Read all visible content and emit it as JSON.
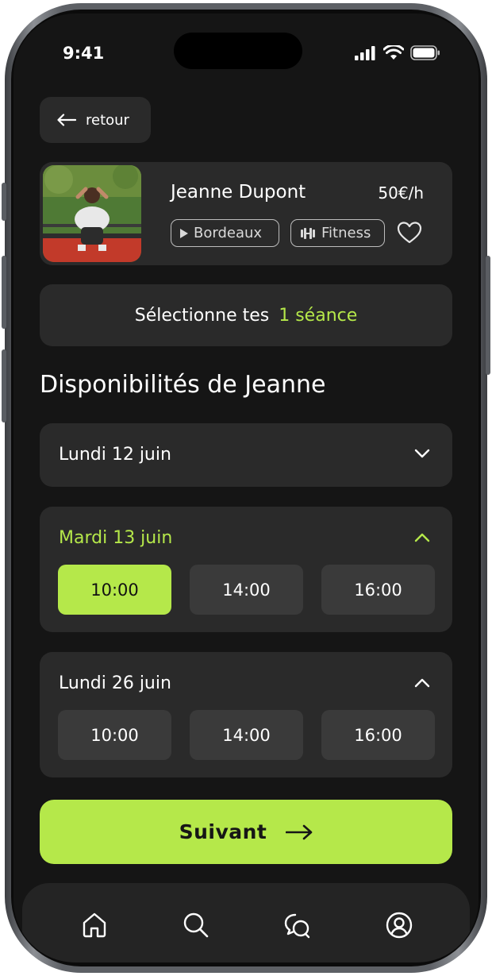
{
  "status_bar": {
    "time": "9:41"
  },
  "back": {
    "label": "retour"
  },
  "coach": {
    "name": "Jeanne Dupont",
    "price": "50€/h",
    "city": "Bordeaux",
    "sport": "Fitness"
  },
  "selection": {
    "prefix": "Sélectionne tes",
    "count": "1 séance"
  },
  "section_title": "Disponibilités de Jeanne",
  "days": [
    {
      "label": "Lundi 12 juin",
      "expanded": false,
      "slots": []
    },
    {
      "label": "Mardi 13 juin",
      "expanded": true,
      "active": true,
      "slots": [
        {
          "time": "10:00",
          "selected": true
        },
        {
          "time": "14:00",
          "selected": false
        },
        {
          "time": "16:00",
          "selected": false
        }
      ]
    },
    {
      "label": "Lundi 26 juin",
      "expanded": true,
      "slots": [
        {
          "time": "10:00",
          "selected": false
        },
        {
          "time": "14:00",
          "selected": false
        },
        {
          "time": "16:00",
          "selected": false
        }
      ]
    }
  ],
  "next_button": {
    "label": "Suivant"
  },
  "tabbar": {
    "icons": [
      "home-icon",
      "search-icon",
      "chat-icon",
      "profile-icon"
    ]
  },
  "colors": {
    "accent": "#b5e84a",
    "card": "#2a2a2a",
    "background": "#151515",
    "slot": "#3a3a3a"
  }
}
